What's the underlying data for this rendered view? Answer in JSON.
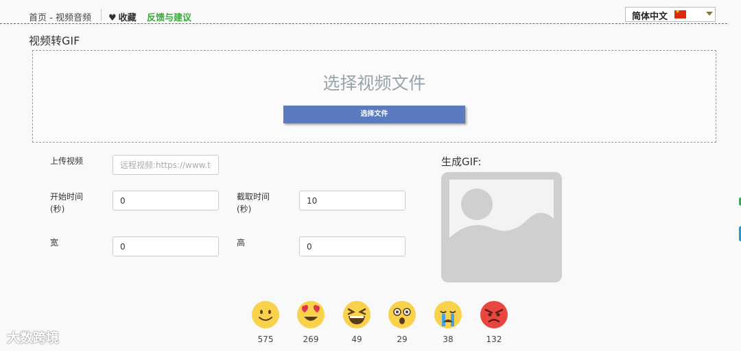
{
  "header": {
    "breadcrumb": "首页 - 视频音频",
    "favorite_label": "收藏",
    "feedback_label": "反馈与建议",
    "language": {
      "selected": "简体中文",
      "flag_icon": "cn-flag-icon"
    }
  },
  "page": {
    "title": "视频转GIF"
  },
  "upload": {
    "drop_label": "选择视频文件",
    "choose_button": "选择文件"
  },
  "form": {
    "remote_label": "上传视频",
    "remote_placeholder": "远程视频:https://www.too",
    "start_label_line1": "开始时间",
    "start_label_line2": "(秒)",
    "start_value": "0",
    "duration_label_line1": "截取时间",
    "duration_label_line2": "(秒)",
    "duration_value": "10",
    "width_label": "宽",
    "width_value": "0",
    "height_label": "高",
    "height_value": "0"
  },
  "result": {
    "title": "生成GIF:",
    "placeholder_icon": "image-placeholder-icon"
  },
  "reactions": [
    {
      "icon": "smile-icon",
      "count": "575"
    },
    {
      "icon": "heart-eyes-icon",
      "count": "269"
    },
    {
      "icon": "laughing-icon",
      "count": "49"
    },
    {
      "icon": "surprised-icon",
      "count": "29"
    },
    {
      "icon": "crying-icon",
      "count": "38"
    },
    {
      "icon": "angry-icon",
      "count": "132"
    }
  ],
  "watermark": "大数跨境",
  "colors": {
    "feedback": "#3aa83a",
    "button": "#5b7bc0",
    "dropzone_border": "#8f8fd0"
  }
}
